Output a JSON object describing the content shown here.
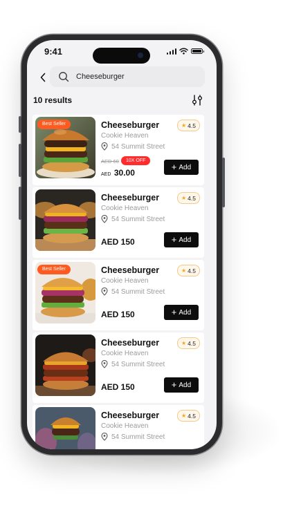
{
  "status_bar": {
    "time": "9:41"
  },
  "search": {
    "value": "Cheeseburger",
    "placeholder": ""
  },
  "results_label": "10 results",
  "products": [
    {
      "title": "Cheeseburger",
      "shop": "Cookie Heaven",
      "address": "54 Summit Street",
      "rating": "4.5",
      "badge": "Best Seller",
      "old_price": "AED 60",
      "discount": "10X OFF",
      "currency": "AED",
      "new_price": "30.00",
      "add_label": "Add"
    },
    {
      "title": "Cheeseburger",
      "shop": "Cookie Heaven",
      "address": "54 Summit Street",
      "rating": "4.5",
      "price": "AED 150",
      "add_label": "Add"
    },
    {
      "title": "Cheeseburger",
      "shop": "Cookie Heaven",
      "address": "54 Summit Street",
      "rating": "4.5",
      "badge": "Best Seller",
      "price": "AED 150",
      "add_label": "Add"
    },
    {
      "title": "Cheeseburger",
      "shop": "Cookie Heaven",
      "address": "54 Summit Street",
      "rating": "4.5",
      "price": "AED 150",
      "add_label": "Add"
    },
    {
      "title": "Cheeseburger",
      "shop": "Cookie Heaven",
      "address": "54 Summit Street",
      "rating": "4.5"
    }
  ],
  "icons": {
    "back": "chevron-left-icon",
    "search": "search-icon",
    "filter": "filter-icon",
    "location": "location-pin-icon",
    "star": "star-icon",
    "plus": "plus-icon"
  },
  "colors": {
    "accent_badge": "#ff5a1f",
    "discount": "#ff2d2d",
    "star": "#f5a623",
    "add_button": "#0d0d0d"
  }
}
